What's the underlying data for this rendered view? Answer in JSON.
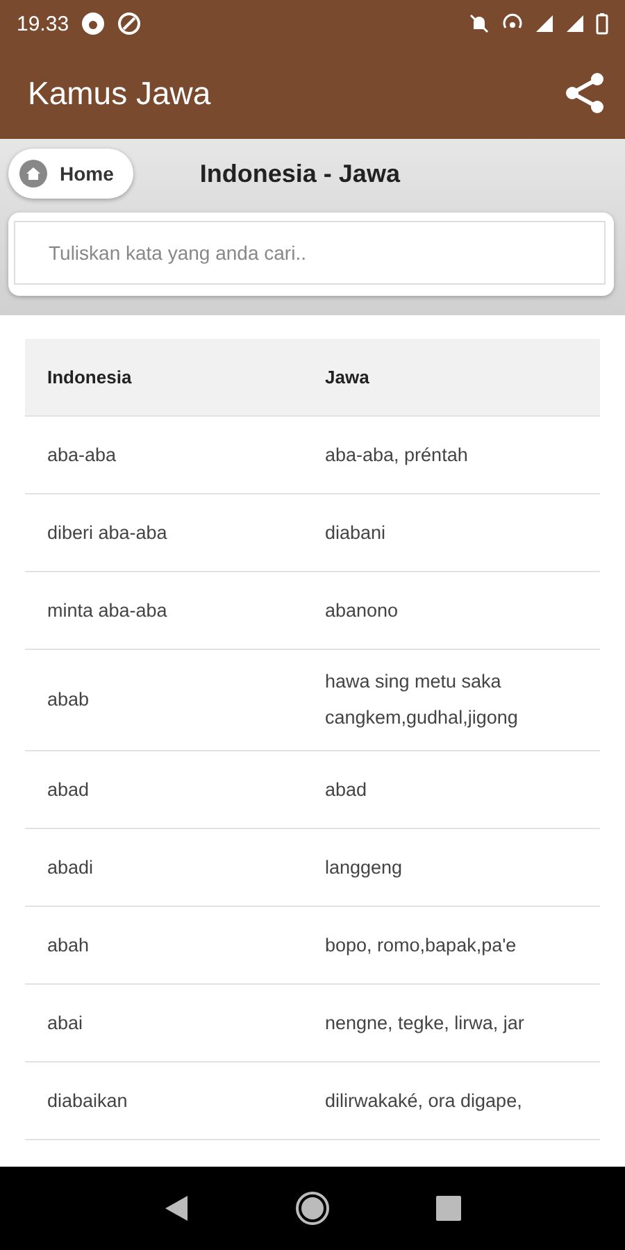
{
  "status_bar": {
    "time": "19.33"
  },
  "app_bar": {
    "title": "Kamus Jawa"
  },
  "header": {
    "home_button": "Home",
    "title": "Indonesia - Jawa"
  },
  "search": {
    "placeholder": "Tuliskan kata yang anda cari.."
  },
  "table": {
    "columns": [
      "Indonesia",
      "Jawa"
    ],
    "rows": [
      {
        "indonesia": "aba-aba",
        "jawa": "aba-aba, préntah"
      },
      {
        "indonesia": "diberi aba-aba",
        "jawa": "diabani"
      },
      {
        "indonesia": "minta aba-aba",
        "jawa": "abanono"
      },
      {
        "indonesia": "abab",
        "jawa": "hawa sing metu saka cangkem,gudhal,jigong"
      },
      {
        "indonesia": "abad",
        "jawa": "abad"
      },
      {
        "indonesia": "abadi",
        "jawa": "langgeng"
      },
      {
        "indonesia": "abah",
        "jawa": "bopo, romo,bapak,pa'e"
      },
      {
        "indonesia": "abai",
        "jawa": "nengne, tegke, lirwa, jar"
      },
      {
        "indonesia": "diabaikan",
        "jawa": "dilirwakaké, ora digape,"
      }
    ]
  }
}
